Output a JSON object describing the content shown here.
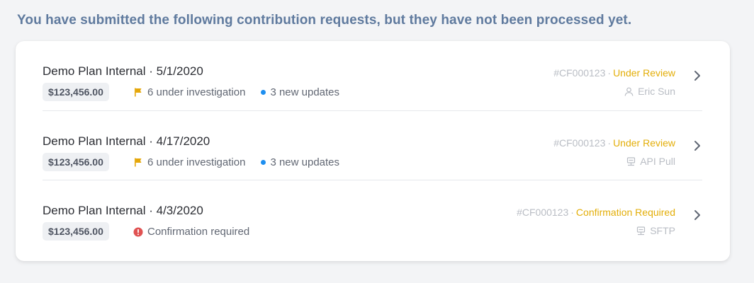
{
  "heading": "You have submitted the following contribution requests, but they have not been processed yet.",
  "colors": {
    "heading": "#5f7a9e",
    "state": "#e3ae08",
    "flag": "#e5a70a",
    "dot": "#1e8ff0",
    "alert": "#e05252"
  },
  "rows": [
    {
      "title": "Demo Plan Internal · 5/1/2020",
      "amount": "$123,456.00",
      "status_icon": "flag-icon",
      "status_text": "6 under investigation",
      "updates_text": "3 new updates",
      "ref": "#CF000123",
      "separator": "·",
      "state": "Under Review",
      "source_icon": "user-icon",
      "source": "Eric Sun"
    },
    {
      "title": "Demo Plan Internal · 4/17/2020",
      "amount": "$123,456.00",
      "status_icon": "flag-icon",
      "status_text": "6 under investigation",
      "updates_text": "3 new updates",
      "ref": "#CF000123",
      "separator": "·",
      "state": "Under Review",
      "source_icon": "server-icon",
      "source": "API Pull"
    },
    {
      "title": "Demo Plan Internal · 4/3/2020",
      "amount": "$123,456.00",
      "status_icon": "alert-icon",
      "status_text": "Confirmation required",
      "ref": "#CF000123",
      "separator": "·",
      "state": "Confirmation Required",
      "source_icon": "server-icon",
      "source": "SFTP"
    }
  ]
}
